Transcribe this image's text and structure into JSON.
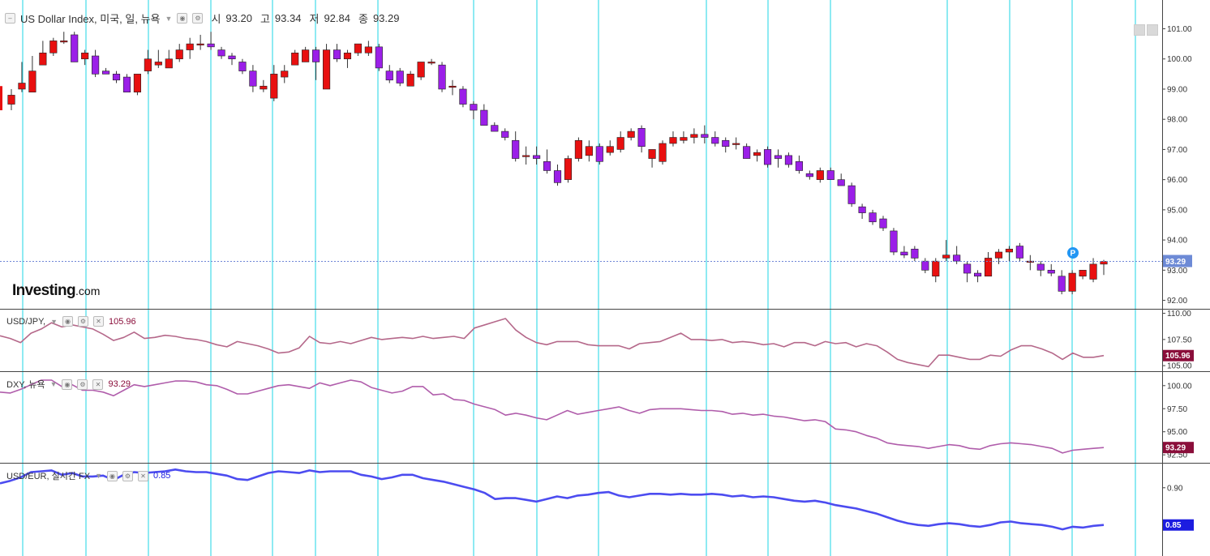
{
  "instrument": {
    "title": "US Dollar Index, 미국, 일, 뉴욕",
    "open_label": "시",
    "open": "93.20",
    "high_label": "고",
    "high": "93.34",
    "low_label": "저",
    "low": "92.84",
    "close_label": "종",
    "close": "93.29"
  },
  "logo": {
    "brand": "Investing",
    "suffix": ".com"
  },
  "price_marker": {
    "label": "P",
    "color": "#2196f3"
  },
  "colors": {
    "up": "#e81010",
    "down": "#9b1fe8",
    "grid_v": "#1ed6e6",
    "last_price_line": "#6f86d6",
    "usdjpy": "#b5688a",
    "dxy": "#b05dab",
    "usdeur": "#4c4cf0",
    "label_bg_dark": "#8a0e3a",
    "label_bg_blue": "#1c1ce0"
  },
  "chart_data": [
    {
      "type": "candlestick",
      "title": "US Dollar Index, 미국, 일, 뉴욕",
      "ylim": [
        91.8,
        101.9
      ],
      "y_ticks": [
        "101.00",
        "100.00",
        "99.00",
        "98.00",
        "97.00",
        "96.00",
        "95.00",
        "94.00",
        "93.00",
        "92.00"
      ],
      "last_price_label": "93.29",
      "last_price": 93.29,
      "marker_index": 68,
      "ohlc": [
        [
          98.5,
          99.0,
          98.3,
          98.8
        ],
        [
          99.0,
          99.9,
          98.9,
          99.2
        ],
        [
          98.9,
          100.1,
          98.9,
          99.6
        ],
        [
          99.8,
          100.6,
          99.8,
          100.2
        ],
        [
          100.2,
          100.7,
          100.1,
          100.6
        ],
        [
          100.6,
          100.9,
          100.5,
          100.6
        ],
        [
          100.8,
          100.9,
          99.9,
          99.9
        ],
        [
          100.0,
          100.3,
          99.8,
          100.2
        ],
        [
          100.1,
          100.3,
          99.4,
          99.5
        ],
        [
          99.6,
          99.7,
          99.5,
          99.5
        ],
        [
          99.5,
          99.6,
          99.2,
          99.3
        ],
        [
          99.4,
          99.5,
          98.9,
          98.9
        ],
        [
          98.9,
          99.5,
          98.8,
          99.5
        ],
        [
          99.6,
          100.3,
          99.5,
          100.0
        ],
        [
          99.8,
          100.3,
          99.7,
          99.9
        ],
        [
          99.7,
          100.3,
          99.7,
          100.0
        ],
        [
          100.0,
          100.5,
          99.9,
          100.3
        ],
        [
          100.3,
          100.7,
          100.0,
          100.5
        ],
        [
          100.5,
          100.8,
          100.3,
          100.5
        ],
        [
          100.5,
          100.9,
          100.3,
          100.4
        ],
        [
          100.3,
          100.4,
          100.0,
          100.1
        ],
        [
          100.1,
          100.2,
          99.8,
          100.0
        ],
        [
          99.9,
          100.0,
          99.5,
          99.6
        ],
        [
          99.6,
          99.8,
          98.9,
          99.1
        ],
        [
          99.0,
          99.3,
          98.9,
          99.1
        ],
        [
          98.7,
          99.8,
          98.6,
          99.5
        ],
        [
          99.4,
          99.8,
          99.2,
          99.6
        ],
        [
          99.8,
          100.3,
          99.8,
          100.2
        ],
        [
          99.9,
          100.4,
          99.9,
          100.3
        ],
        [
          100.3,
          100.4,
          99.3,
          99.9
        ],
        [
          99.0,
          100.5,
          99.0,
          100.3
        ],
        [
          100.3,
          100.5,
          99.9,
          100.0
        ],
        [
          100.0,
          100.3,
          99.7,
          100.2
        ],
        [
          100.2,
          100.5,
          100.1,
          100.5
        ],
        [
          100.2,
          100.6,
          100.1,
          100.4
        ],
        [
          100.4,
          100.5,
          99.6,
          99.7
        ],
        [
          99.6,
          99.8,
          99.2,
          99.3
        ],
        [
          99.6,
          99.7,
          99.1,
          99.2
        ],
        [
          99.1,
          99.6,
          99.1,
          99.5
        ],
        [
          99.4,
          99.9,
          99.3,
          99.9
        ],
        [
          99.9,
          100.0,
          99.8,
          99.9
        ],
        [
          99.8,
          99.9,
          98.9,
          99.0
        ],
        [
          99.1,
          99.3,
          98.8,
          99.1
        ],
        [
          99.0,
          99.1,
          98.4,
          98.5
        ],
        [
          98.5,
          98.6,
          98.0,
          98.3
        ],
        [
          98.3,
          98.5,
          97.8,
          97.8
        ],
        [
          97.8,
          97.9,
          97.6,
          97.6
        ],
        [
          97.6,
          97.7,
          97.3,
          97.4
        ],
        [
          97.3,
          97.6,
          96.6,
          96.7
        ],
        [
          96.8,
          97.1,
          96.5,
          96.8
        ],
        [
          96.8,
          97.1,
          96.5,
          96.7
        ],
        [
          96.6,
          97.0,
          96.2,
          96.3
        ],
        [
          96.3,
          96.5,
          95.8,
          95.9
        ],
        [
          96.0,
          96.8,
          95.9,
          96.7
        ],
        [
          96.7,
          97.4,
          96.6,
          97.3
        ],
        [
          96.8,
          97.3,
          96.6,
          97.1
        ],
        [
          97.1,
          97.2,
          96.5,
          96.6
        ],
        [
          96.9,
          97.3,
          96.8,
          97.1
        ],
        [
          97.0,
          97.6,
          96.9,
          97.4
        ],
        [
          97.4,
          97.7,
          97.3,
          97.6
        ],
        [
          97.7,
          97.8,
          96.9,
          97.1
        ],
        [
          96.7,
          97.0,
          96.4,
          97.0
        ],
        [
          96.6,
          97.3,
          96.5,
          97.2
        ],
        [
          97.2,
          97.6,
          97.1,
          97.4
        ],
        [
          97.3,
          97.6,
          97.2,
          97.4
        ],
        [
          97.4,
          97.7,
          97.2,
          97.5
        ],
        [
          97.5,
          97.8,
          97.2,
          97.4
        ],
        [
          97.4,
          97.6,
          97.1,
          97.2
        ],
        [
          97.3,
          97.4,
          96.9,
          97.1
        ],
        [
          97.2,
          97.4,
          97.0,
          97.2
        ],
        [
          97.1,
          97.2,
          96.7,
          96.7
        ],
        [
          96.8,
          97.0,
          96.6,
          96.9
        ],
        [
          97.0,
          97.1,
          96.4,
          96.5
        ],
        [
          96.8,
          97.0,
          96.4,
          96.7
        ],
        [
          96.8,
          96.9,
          96.4,
          96.5
        ],
        [
          96.6,
          96.8,
          96.2,
          96.3
        ],
        [
          96.2,
          96.3,
          96.0,
          96.1
        ],
        [
          96.0,
          96.4,
          95.9,
          96.3
        ],
        [
          96.3,
          96.4,
          96.0,
          96.0
        ],
        [
          96.0,
          96.2,
          95.8,
          95.8
        ],
        [
          95.8,
          95.9,
          95.1,
          95.2
        ],
        [
          95.1,
          95.2,
          94.7,
          94.9
        ],
        [
          94.9,
          95.0,
          94.5,
          94.6
        ],
        [
          94.7,
          94.8,
          94.3,
          94.4
        ],
        [
          94.3,
          94.4,
          93.5,
          93.6
        ],
        [
          93.6,
          93.8,
          93.4,
          93.5
        ],
        [
          93.7,
          93.8,
          93.3,
          93.4
        ],
        [
          93.3,
          93.4,
          92.9,
          93.0
        ],
        [
          92.8,
          93.4,
          92.6,
          93.3
        ],
        [
          93.4,
          94.0,
          93.3,
          93.5
        ],
        [
          93.5,
          93.8,
          93.2,
          93.3
        ],
        [
          93.2,
          93.3,
          92.6,
          92.9
        ],
        [
          92.9,
          93.0,
          92.6,
          92.8
        ],
        [
          92.8,
          93.6,
          92.8,
          93.4
        ],
        [
          93.4,
          93.7,
          93.2,
          93.6
        ],
        [
          93.6,
          93.8,
          93.3,
          93.7
        ],
        [
          93.8,
          93.9,
          93.3,
          93.4
        ],
        [
          93.3,
          93.5,
          93.0,
          93.3
        ],
        [
          93.2,
          93.3,
          92.8,
          93.0
        ],
        [
          93.0,
          93.2,
          92.8,
          92.9
        ],
        [
          92.8,
          93.0,
          92.2,
          92.3
        ],
        [
          92.3,
          93.0,
          92.2,
          92.9
        ],
        [
          92.8,
          93.0,
          92.7,
          93.0
        ],
        [
          92.7,
          93.4,
          92.6,
          93.2
        ],
        [
          93.2,
          93.34,
          92.84,
          93.29
        ]
      ]
    },
    {
      "type": "line",
      "series_name": "USD/JPY,",
      "value_label": "105.96",
      "ylim": [
        104.7,
        110.2
      ],
      "y_ticks": [
        "110.00",
        "107.50",
        "105.00"
      ],
      "values": [
        107.85,
        107.6,
        107.2,
        108.1,
        108.5,
        109.1,
        108.7,
        108.9,
        108.7,
        108.5,
        108.0,
        107.4,
        107.7,
        108.2,
        107.6,
        107.7,
        107.9,
        107.8,
        107.6,
        107.5,
        107.3,
        107.0,
        106.8,
        107.3,
        107.1,
        106.9,
        106.6,
        106.2,
        106.3,
        106.7,
        107.8,
        107.2,
        107.1,
        107.3,
        107.1,
        107.4,
        107.7,
        107.5,
        107.6,
        107.7,
        107.6,
        107.8,
        107.6,
        107.7,
        107.8,
        107.6,
        108.6,
        108.9,
        109.2,
        109.5,
        108.4,
        107.7,
        107.2,
        107.0,
        107.3,
        107.3,
        107.3,
        107.0,
        106.9,
        106.9,
        106.9,
        106.6,
        107.1,
        107.2,
        107.3,
        107.7,
        108.1,
        107.5,
        107.5,
        107.4,
        107.5,
        107.2,
        107.3,
        107.2,
        107.0,
        107.1,
        106.8,
        107.2,
        107.2,
        106.9,
        107.3,
        107.1,
        107.2,
        106.8,
        107.1,
        106.9,
        106.3,
        105.6,
        105.3,
        105.1,
        104.9,
        106.0,
        106.0,
        105.8,
        105.6,
        105.6,
        106.0,
        105.9,
        106.5,
        106.9,
        106.9,
        106.6,
        106.2,
        105.6,
        106.2,
        105.8,
        105.8,
        105.96
      ]
    },
    {
      "type": "line",
      "series_name": "DXY, 뉴욕",
      "value_label": "93.29",
      "ylim": [
        91.9,
        101.3
      ],
      "y_ticks": [
        "100.00",
        "97.50",
        "95.00",
        "92.50"
      ],
      "values": [
        99.3,
        99.2,
        99.6,
        100.1,
        100.6,
        100.6,
        99.9,
        100.1,
        99.5,
        99.5,
        99.3,
        98.9,
        99.5,
        100.1,
        99.9,
        100.1,
        100.3,
        100.5,
        100.5,
        100.4,
        100.1,
        100.0,
        99.6,
        99.1,
        99.1,
        99.4,
        99.7,
        100.0,
        100.1,
        99.9,
        99.7,
        100.3,
        100.0,
        100.3,
        100.6,
        100.4,
        99.8,
        99.5,
        99.2,
        99.4,
        99.9,
        99.9,
        99.0,
        99.1,
        98.5,
        98.4,
        98.0,
        97.7,
        97.4,
        96.8,
        97.0,
        96.8,
        96.5,
        96.3,
        96.8,
        97.3,
        96.9,
        97.1,
        97.3,
        97.5,
        97.7,
        97.3,
        97.0,
        97.4,
        97.5,
        97.5,
        97.5,
        97.4,
        97.3,
        97.3,
        97.2,
        96.9,
        97.0,
        96.8,
        96.9,
        96.7,
        96.6,
        96.4,
        96.2,
        96.3,
        96.1,
        95.3,
        95.2,
        95.0,
        94.6,
        94.3,
        93.8,
        93.6,
        93.5,
        93.4,
        93.2,
        93.4,
        93.6,
        93.5,
        93.2,
        93.1,
        93.5,
        93.7,
        93.8,
        93.7,
        93.6,
        93.4,
        93.2,
        92.7,
        93.0,
        93.1,
        93.2,
        93.29
      ]
    },
    {
      "type": "line",
      "series_name": "USD/EUR, 실시간 FX",
      "value_label": "0.85",
      "ylim": [
        0.824,
        0.926
      ],
      "y_ticks": [
        "0.90"
      ],
      "values": [
        0.905,
        0.908,
        0.912,
        0.918,
        0.919,
        0.92,
        0.915,
        0.917,
        0.913,
        0.913,
        0.914,
        0.909,
        0.915,
        0.918,
        0.917,
        0.918,
        0.919,
        0.921,
        0.919,
        0.918,
        0.918,
        0.916,
        0.914,
        0.91,
        0.909,
        0.913,
        0.917,
        0.919,
        0.918,
        0.917,
        0.92,
        0.918,
        0.919,
        0.919,
        0.919,
        0.915,
        0.913,
        0.91,
        0.912,
        0.915,
        0.915,
        0.911,
        0.909,
        0.907,
        0.904,
        0.901,
        0.898,
        0.894,
        0.887,
        0.888,
        0.888,
        0.886,
        0.884,
        0.887,
        0.89,
        0.888,
        0.891,
        0.892,
        0.894,
        0.895,
        0.891,
        0.889,
        0.891,
        0.893,
        0.893,
        0.892,
        0.893,
        0.892,
        0.892,
        0.893,
        0.892,
        0.89,
        0.891,
        0.889,
        0.89,
        0.889,
        0.887,
        0.885,
        0.884,
        0.885,
        0.883,
        0.88,
        0.878,
        0.876,
        0.873,
        0.87,
        0.866,
        0.862,
        0.859,
        0.857,
        0.856,
        0.858,
        0.859,
        0.858,
        0.856,
        0.855,
        0.857,
        0.86,
        0.861,
        0.859,
        0.858,
        0.857,
        0.855,
        0.852,
        0.855,
        0.854,
        0.856,
        0.857
      ]
    }
  ]
}
